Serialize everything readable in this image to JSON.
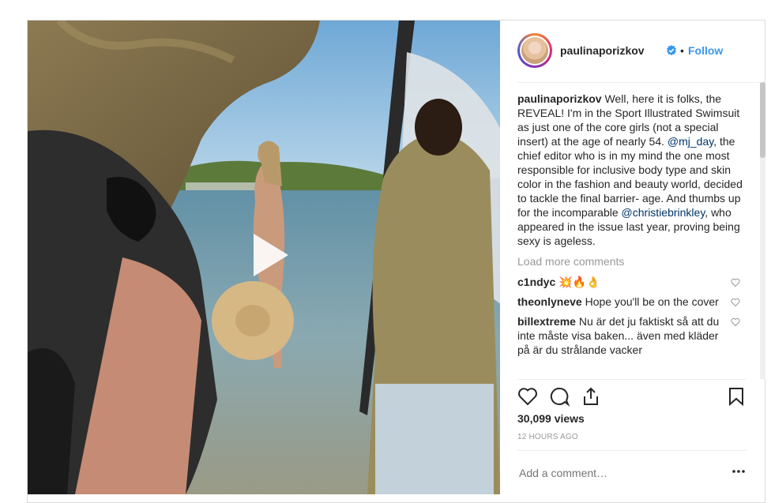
{
  "post": {
    "username": "paulinaporizkov",
    "dot": "•",
    "follow_label": "Follow",
    "avatar_icon": "profile-photo",
    "caption": {
      "username": "paulinaporizkov",
      "part1": "Well, here it is folks, the REVEAL! I'm in the Sport Illustrated Swimsuit as just one of the core girls (not a special insert) at the age of nearly 54.",
      "mention1": "@mj_day",
      "part2": ", the chief editor who is in my mind the one most responsible for inclusive body type and skin color in the fashion and beauty world, decided to tackle the final barrier- age. And thumbs up for the incomparable",
      "mention2": "@christiebrinkley",
      "part3": ", who appeared in the issue last year, proving being sexy is ageless."
    },
    "load_more": "Load more comments",
    "comments": [
      {
        "user": "c1ndyc",
        "text": "💥🔥👌"
      },
      {
        "user": "theonlyneve",
        "text": "Hope you'll be on the cover"
      },
      {
        "user": "billextreme",
        "text": "Nu är det ju faktiskt så att du inte måste visa baken... även med kläder på är du strålande vacker"
      }
    ],
    "views": "30,099 views",
    "time": "12 HOURS AGO",
    "add_comment_placeholder": "Add a comment…"
  },
  "colors": {
    "link_blue": "#3897f0",
    "mention_blue": "#003569",
    "muted": "#999999",
    "border": "#dbdbdb"
  }
}
